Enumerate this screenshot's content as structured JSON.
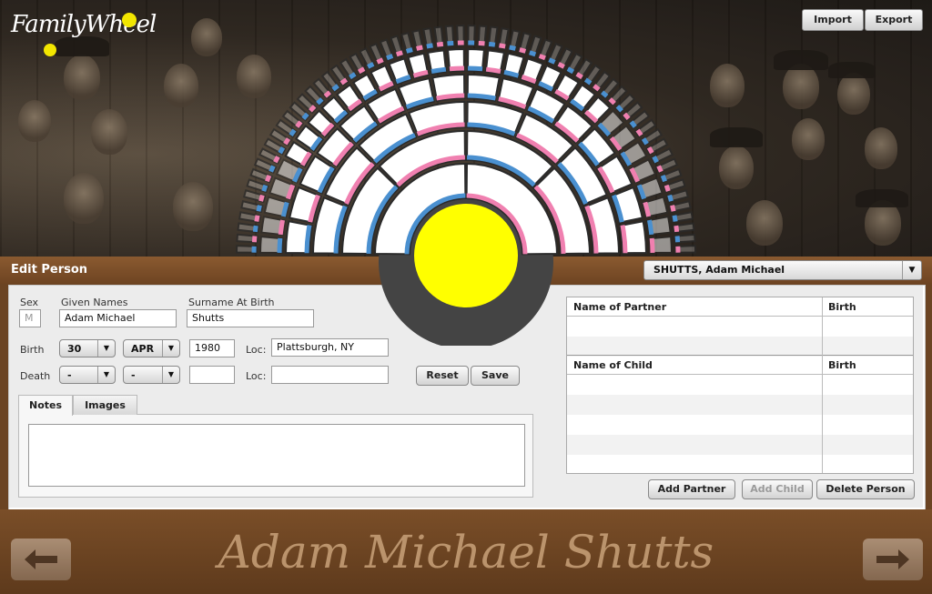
{
  "app": {
    "logo_text": "FamilyWheel"
  },
  "toolbar": {
    "import_label": "Import",
    "export_label": "Export"
  },
  "edit": {
    "title": "Edit Person",
    "person_select": "SHUTTS, Adam Michael",
    "sex_label": "Sex",
    "sex_value": "M",
    "given_label": "Given Names",
    "given_value": "Adam Michael",
    "surname_label": "Surname At Birth",
    "surname_value": "Shutts",
    "birth_label": "Birth",
    "birth_day": "30",
    "birth_month": "APR",
    "birth_year": "1980",
    "loc_label": "Loc:",
    "birth_loc": "Plattsburgh, NY",
    "death_label": "Death",
    "death_day": "-",
    "death_month": "-",
    "death_year": "",
    "death_loc": "",
    "reset_label": "Reset",
    "save_label": "Save",
    "tab_notes": "Notes",
    "tab_images": "Images"
  },
  "relations": {
    "partner_header": "Name of Partner",
    "partner_birth_header": "Birth",
    "child_header": "Name of Child",
    "child_birth_header": "Birth",
    "add_partner_label": "Add Partner",
    "add_child_label": "Add Child",
    "delete_label": "Delete Person"
  },
  "footer": {
    "name": "Adam Michael Shutts"
  },
  "colors": {
    "male": "#4a90d0",
    "female": "#f080b0",
    "center": "#ffff00",
    "brown": "#6b4423"
  },
  "icons": [
    "left-arrow-icon",
    "right-arrow-icon",
    "dropdown-arrow-icon"
  ]
}
